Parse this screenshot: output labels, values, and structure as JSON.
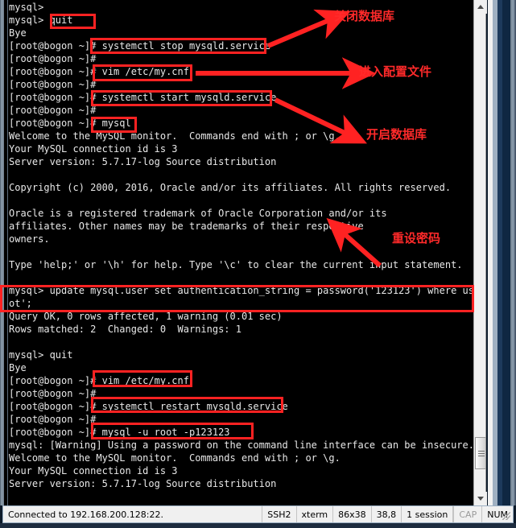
{
  "window": {
    "app": "SSH terminal",
    "scrollbar": {
      "up_arrow": "scroll-up",
      "down_arrow": "scroll-down"
    }
  },
  "terminal": {
    "prompt_user": "[root@bogon ~]#",
    "lines": [
      "mysql>",
      "mysql> quit",
      "Bye",
      "[root@bogon ~]# systemctl stop mysqld.service",
      "[root@bogon ~]#",
      "[root@bogon ~]# vim /etc/my.cnf",
      "[root@bogon ~]#",
      "[root@bogon ~]# systemctl start mysqld.service",
      "[root@bogon ~]#",
      "[root@bogon ~]# mysql",
      "Welcome to the MySQL monitor.  Commands end with ; or \\g.",
      "Your MySQL connection id is 3",
      "Server version: 5.7.17-log Source distribution",
      "",
      "Copyright (c) 2000, 2016, Oracle and/or its affiliates. All rights reserved.",
      "",
      "Oracle is a registered trademark of Oracle Corporation and/or its",
      "affiliates. Other names may be trademarks of their respective",
      "owners.",
      "",
      "Type 'help;' or '\\h' for help. Type '\\c' to clear the current input statement.",
      "",
      "mysql> update mysql.user set authentication_string = password('123123') where user='ro",
      "ot';",
      "Query OK, 0 rows affected, 1 warning (0.01 sec)",
      "Rows matched: 2  Changed: 0  Warnings: 1",
      "",
      "mysql> quit",
      "Bye",
      "[root@bogon ~]# vim /etc/my.cnf",
      "[root@bogon ~]#",
      "[root@bogon ~]# systemctl restart mysqld.service",
      "[root@bogon ~]#",
      "[root@bogon ~]# mysql -u root -p123123",
      "mysql: [Warning] Using a password on the command line interface can be insecure.",
      "Welcome to the MySQL monitor.  Commands end with ; or \\g.",
      "Your MySQL connection id is 3",
      "Server version: 5.7.17-log Source distribution"
    ]
  },
  "annotations": {
    "color": "#ff2a2a",
    "labels": [
      {
        "id": "shutdown-db",
        "text": "关闭数据库"
      },
      {
        "id": "edit-config",
        "text": "进入配置文件"
      },
      {
        "id": "start-db",
        "text": "开启数据库"
      },
      {
        "id": "reset-passwd",
        "text": "重设密码"
      }
    ],
    "highlights": [
      {
        "id": "cmd-quit",
        "command": "quit"
      },
      {
        "id": "cmd-systemctl-stop",
        "command": "systemctl stop mysqld.service"
      },
      {
        "id": "cmd-vim-my-cnf-1",
        "command": "vim /etc/my.cnf"
      },
      {
        "id": "cmd-systemctl-start",
        "command": "systemctl start mysqld.service"
      },
      {
        "id": "cmd-mysql",
        "command": "mysql"
      },
      {
        "id": "cmd-update-password",
        "command": "update mysql.user set authentication_string = password('123123') where user='root';"
      },
      {
        "id": "cmd-vim-my-cnf-2",
        "command": "vim /etc/my.cnf"
      },
      {
        "id": "cmd-systemctl-restart",
        "command": "systemctl restart mysqld.service"
      },
      {
        "id": "cmd-mysql-login",
        "command": "mysql -u root -p123123"
      }
    ]
  },
  "status_bar": {
    "connection": "Connected to 192.168.200.128:22.",
    "protocol": "SSH2",
    "emulation": "xterm",
    "size": "86x38",
    "cursor": "38,8",
    "sessions": "1 session",
    "caps": "CAP",
    "num": "NUM"
  }
}
